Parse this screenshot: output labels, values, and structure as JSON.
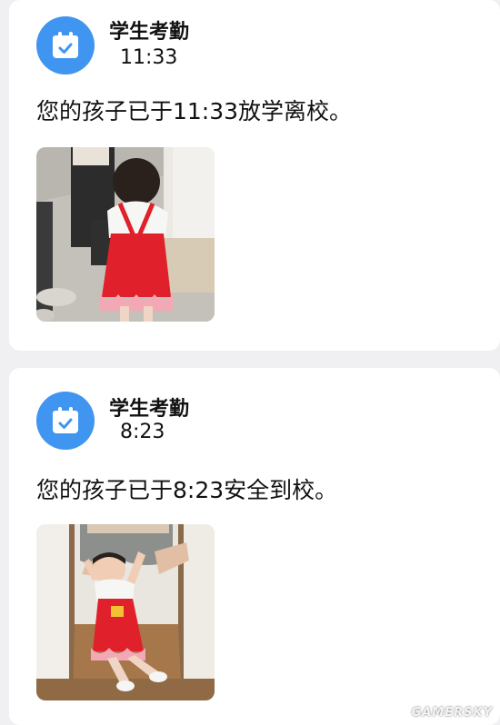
{
  "notifications": [
    {
      "app_name": "学生考勤",
      "time": "11:33",
      "icon": "calendar-check-icon",
      "message": "您的孩子已于11:33放学离校。",
      "photo": "child-leaving-school-photo"
    },
    {
      "app_name": "学生考勤",
      "time": "8:23",
      "icon": "calendar-check-icon",
      "message": "您的孩子已于8:23安全到校。",
      "photo": "child-arriving-school-photo"
    }
  ],
  "watermark": "GAMERSKY",
  "colors": {
    "background": "#f0f0f2",
    "card": "#ffffff",
    "icon_blue": "#3f95ef",
    "dress_red": "#e0202a"
  }
}
